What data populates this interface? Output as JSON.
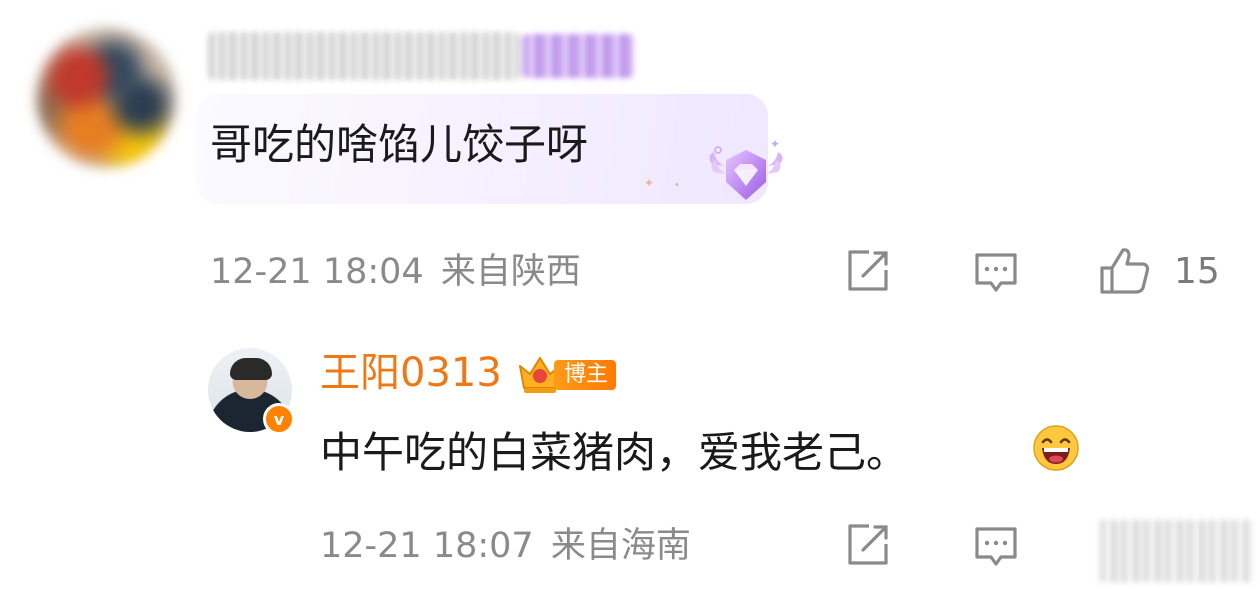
{
  "comment": {
    "text": "哥吃的啥馅儿饺子呀",
    "time": "12-21 18:04",
    "location": "来自陕西",
    "like_count": "15"
  },
  "reply": {
    "username": "王阳0313",
    "tag": "博主",
    "text": "中午吃的白菜猪肉，爱我老己。",
    "time": "12-21 18:07",
    "location": "来自海南"
  },
  "colors": {
    "accent": "#f07814",
    "meta_text": "#8a8a8a",
    "icon": "#8a8a8a"
  },
  "icons": [
    "repost-icon",
    "comment-icon",
    "like-icon",
    "gem-badge-icon",
    "crown-icon",
    "laugh-emoji-icon",
    "verified-icon"
  ]
}
